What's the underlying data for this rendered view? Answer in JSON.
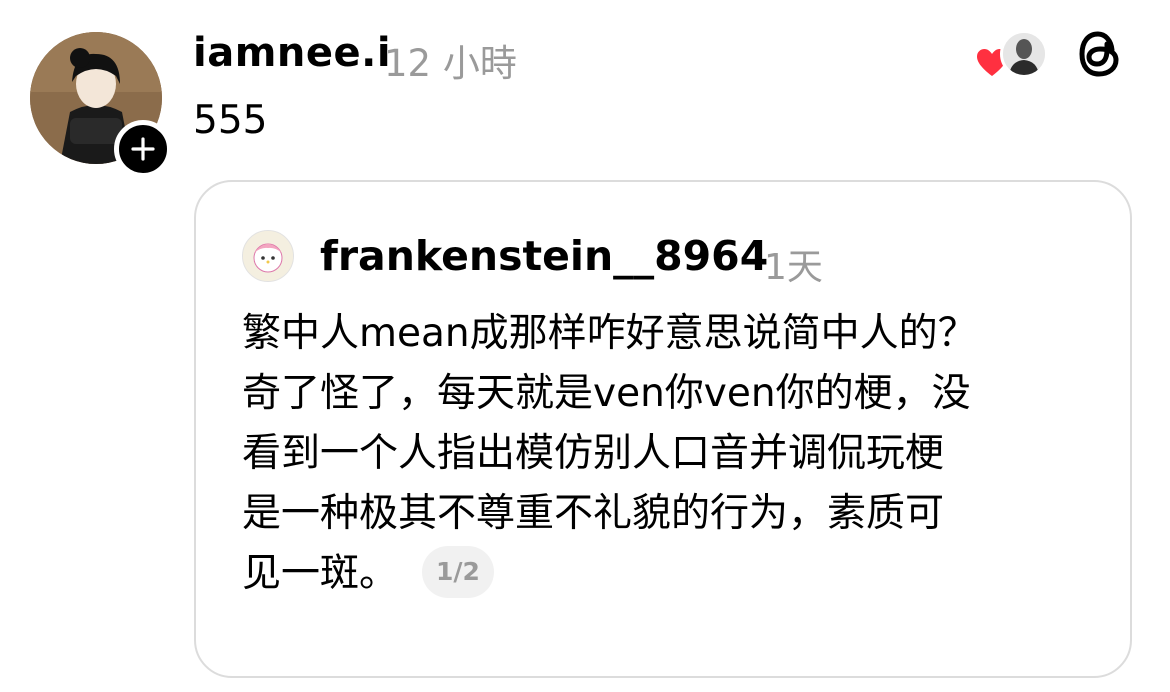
{
  "post": {
    "author": {
      "username": "iamnee.i",
      "avatar_icon": "user-avatar-illustration",
      "follow_icon": "plus-icon"
    },
    "time": "12 小時",
    "text": "555",
    "likes": {
      "heart_color": "#ff3040",
      "liker_avatar_icon": "user-avatar-photo"
    },
    "app_icon": "threads-logo-icon"
  },
  "quoted_post": {
    "author": {
      "username": "frankenstein__8964",
      "avatar_icon": "user-avatar-cartoon"
    },
    "time": "1天",
    "text_lines": [
      "繁中人mean成那样咋好意思说简中人的？",
      "奇了怪了，每天就是ven你ven你的梗，没",
      "看到一个人指出模仿别人口音并调侃玩梗",
      "是一种极其不尊重不礼貌的行为，素质可",
      "见一斑。"
    ],
    "pager": "1/2"
  }
}
